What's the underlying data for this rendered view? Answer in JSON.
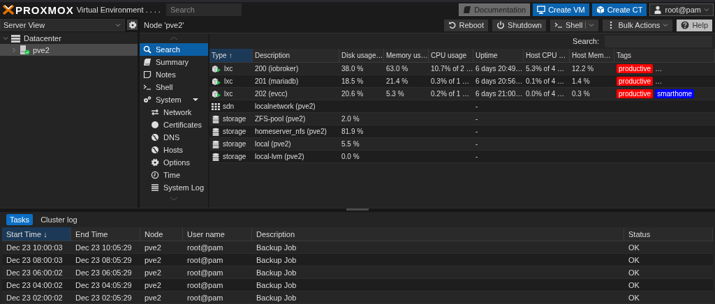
{
  "header": {
    "product": "PROXMOX",
    "subtitle": "Virtual Environment . . . .",
    "search": {
      "placeholder": "Search"
    },
    "buttons": [
      {
        "label": "Documentation",
        "kind": "docs"
      },
      {
        "label": "Create VM",
        "kind": "vm"
      },
      {
        "label": "Create CT",
        "kind": "ct"
      },
      {
        "label": "root@pam",
        "kind": "user"
      }
    ]
  },
  "sidebar": {
    "view": "Server View",
    "tree": [
      {
        "label": "Datacenter",
        "kind": "datacenter",
        "expanded": true,
        "selected": false,
        "children": [
          {
            "label": "pve2",
            "kind": "node",
            "online": true,
            "selected": true
          }
        ]
      }
    ]
  },
  "panel": {
    "title": "Node 'pve2'",
    "toolbar": [
      {
        "label": "Reboot",
        "kind": "reboot"
      },
      {
        "label": "Shutdown",
        "kind": "shutdown"
      },
      {
        "label": "Shell",
        "kind": "shell"
      },
      {
        "label": "Bulk Actions",
        "kind": "bulk"
      },
      {
        "label": "Help",
        "kind": "help"
      }
    ],
    "nav": [
      {
        "label": "Search",
        "kind": "search",
        "selected": true
      },
      {
        "label": "Summary",
        "kind": "summary",
        "selected": false
      },
      {
        "label": "Notes",
        "kind": "notes",
        "selected": false
      },
      {
        "label": "Shell",
        "kind": "shell",
        "selected": false
      },
      {
        "label": "System",
        "kind": "system",
        "selected": false,
        "expanded": true,
        "children": [
          {
            "label": "Network",
            "kind": "network",
            "selected": false
          },
          {
            "label": "Certificates",
            "kind": "certificates",
            "selected": false
          },
          {
            "label": "DNS",
            "kind": "globe",
            "selected": false
          },
          {
            "label": "Hosts",
            "kind": "globe",
            "selected": false
          },
          {
            "label": "Options",
            "kind": "options",
            "selected": false
          },
          {
            "label": "Time",
            "kind": "time",
            "selected": false
          },
          {
            "label": "System Log",
            "kind": "log",
            "selected": false
          }
        ]
      }
    ],
    "search_label": "Search:",
    "table": {
      "columns": [
        {
          "label": "Type",
          "sort": "↑",
          "sorted": true
        },
        {
          "label": "Description",
          "sorted": false
        },
        {
          "label": "Disk usage…",
          "sorted": false
        },
        {
          "label": "Memory us…",
          "sorted": false
        },
        {
          "label": "CPU usage",
          "sorted": false
        },
        {
          "label": "Uptime",
          "sorted": false
        },
        {
          "label": "Host CPU …",
          "sorted": false
        },
        {
          "label": "Host Mem…",
          "sorted": false
        },
        {
          "label": "Tags",
          "sorted": false
        }
      ],
      "rows": [
        {
          "kind": "container",
          "running": true,
          "type": "lxc",
          "description": "200 (iobroker)",
          "disk": "38.0 %",
          "memory": "63.0 %",
          "cpu": "10.7% of 2 …",
          "uptime": "6 days 20:49…",
          "host_cpu": "5.3% of 4 …",
          "host_memory": "12.2 %",
          "tags": [
            {
              "label": "productive",
              "color": "#ff0000"
            }
          ],
          "tags_more": "…"
        },
        {
          "kind": "container",
          "running": true,
          "type": "lxc",
          "description": "201 (mariadb)",
          "disk": "18.5 %",
          "memory": "21.4 %",
          "cpu": "0.3% of 1 …",
          "uptime": "6 days 20:56…",
          "host_cpu": "0.1% of 4 …",
          "host_memory": "1.4 %",
          "tags": [
            {
              "label": "productive",
              "color": "#ff0000"
            }
          ],
          "tags_more": "…"
        },
        {
          "kind": "container",
          "running": true,
          "type": "lxc",
          "description": "202 (evcc)",
          "disk": "20.6 %",
          "memory": "5.3 %",
          "cpu": "0.2% of 1 …",
          "uptime": "6 days 21:00…",
          "host_cpu": "0.0% of 4 …",
          "host_memory": "0.3 %",
          "tags": [
            {
              "label": "productive",
              "color": "#ff0000"
            },
            {
              "label": "smarthome",
              "color": "#0000ff"
            }
          ]
        },
        {
          "kind": "network",
          "type": "sdn",
          "description": "localnetwork (pve2)",
          "uptime": "-"
        },
        {
          "kind": "storage",
          "type": "storage",
          "description": "ZFS-pool (pve2)",
          "disk": "2.0 %",
          "uptime": "-"
        },
        {
          "kind": "storage",
          "type": "storage",
          "description": "homeserver_nfs (pve2)",
          "disk": "81.9 %",
          "uptime": "-"
        },
        {
          "kind": "storage",
          "type": "storage",
          "description": "local (pve2)",
          "disk": "5.5 %",
          "uptime": "-"
        },
        {
          "kind": "storage",
          "type": "storage",
          "description": "local-lvm (pve2)",
          "disk": "0.0 %",
          "uptime": "-"
        }
      ]
    }
  },
  "log": {
    "tabs": [
      {
        "label": "Tasks",
        "selected": true
      },
      {
        "label": "Cluster log",
        "selected": false
      }
    ],
    "columns": [
      {
        "label": "Start Time",
        "sort": "↓",
        "sorted": true
      },
      {
        "label": "End Time",
        "sorted": false
      },
      {
        "label": "Node",
        "sorted": false
      },
      {
        "label": "User name",
        "sorted": false
      },
      {
        "label": "Description",
        "sorted": false
      },
      {
        "label": "Status",
        "sorted": false
      }
    ],
    "rows": [
      {
        "cells": [
          "Dec 23 10:00:03",
          "Dec 23 10:05:29",
          "pve2",
          "root@pam",
          "Backup Job",
          "OK"
        ]
      },
      {
        "cells": [
          "Dec 23 08:00:03",
          "Dec 23 08:05:29",
          "pve2",
          "root@pam",
          "Backup Job",
          "OK"
        ]
      },
      {
        "cells": [
          "Dec 23 06:00:02",
          "Dec 23 06:05:29",
          "pve2",
          "root@pam",
          "Backup Job",
          "OK"
        ]
      },
      {
        "cells": [
          "Dec 23 04:00:02",
          "Dec 23 04:05:29",
          "pve2",
          "root@pam",
          "Backup Job",
          "OK"
        ]
      },
      {
        "cells": [
          "Dec 23 02:00:02",
          "Dec 23 02:05:29",
          "pve2",
          "root@pam",
          "Backup Job",
          "OK"
        ]
      }
    ]
  }
}
